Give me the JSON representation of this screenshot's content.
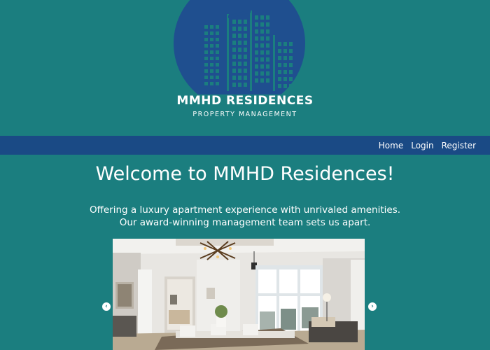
{
  "brand": {
    "name": "MMHD RESIDENCES",
    "tagline": "PROPERTY MANAGEMENT",
    "logo_icon": "city-buildings-logo",
    "colors": {
      "background": "#1b7e7f",
      "navbar": "#1a4a85",
      "logo": "#1f4f8f"
    }
  },
  "nav": {
    "items": [
      {
        "label": "Home"
      },
      {
        "label": "Login"
      },
      {
        "label": "Register"
      }
    ]
  },
  "main": {
    "title": "Welcome to MMHD Residences!",
    "intro_line1": "Offering a luxury apartment experience with unrivaled amenities.",
    "intro_line2": "Our award-winning management team sets us apart."
  },
  "carousel": {
    "prev_icon": "chevron-left-icon",
    "next_icon": "chevron-right-icon",
    "prev_glyph": "‹",
    "next_glyph": "›"
  }
}
